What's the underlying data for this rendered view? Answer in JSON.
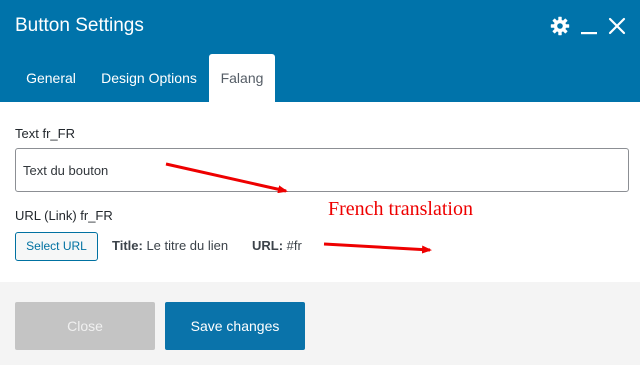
{
  "dialog": {
    "title": "Button Settings",
    "accent_color": "#0073aa",
    "header_icons": [
      "gear-icon",
      "minimize-icon",
      "close-icon"
    ]
  },
  "tabs": [
    {
      "label": "General",
      "active": false
    },
    {
      "label": "Design Options",
      "active": false
    },
    {
      "label": "Falang",
      "active": true
    }
  ],
  "form": {
    "text_label": "Text fr_FR",
    "text_value": "Text du bouton",
    "url_label": "URL (Link) fr_FR",
    "select_url_label": "Select URL",
    "title_key": "Title:",
    "title_value": "Le titre du lien",
    "url_key": "URL:",
    "url_value": "#fr"
  },
  "annotation": {
    "text": "French translation",
    "color": "#ee0000"
  },
  "footer": {
    "close_label": "Close",
    "save_label": "Save changes"
  }
}
